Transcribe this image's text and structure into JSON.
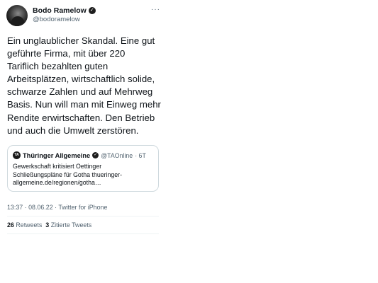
{
  "author": {
    "name": "Bodo Ramelow",
    "handle": "@bodoramelow"
  },
  "menu": {
    "more_label": "···"
  },
  "tweet": {
    "lines": [
      "Ein unglaublicher Skandal. Eine gut",
      "geführte Firma, mit über 220",
      "Tariflich bezahlten guten",
      "Arbeitsplätzen, wirtschaftlich solide,",
      "schwarze Zahlen und auf Mehrweg",
      "Basis. Nun will man mit Einweg mehr",
      "Rendite erwirtschaften. Den Betrieb",
      "und auch die Umwelt zerstören."
    ]
  },
  "quote": {
    "logo_text": "TA",
    "name": "Thüringer Allgemeine",
    "handle": "@TAOnline",
    "age": "· 6T",
    "lines": [
      "Gewerkschaft kritisiert Oettinger",
      "Schließungspläne für Gotha thueringer-",
      "allgemeine.de/regionen/gotha…"
    ]
  },
  "meta": {
    "timestamp": "13:37 · 08.06.22 · Twitter for iPhone"
  },
  "stats": {
    "retweets_count": "26",
    "retweets_label": "Retweets",
    "quotes_count": "3",
    "quotes_label": "Zitierte Tweets"
  }
}
